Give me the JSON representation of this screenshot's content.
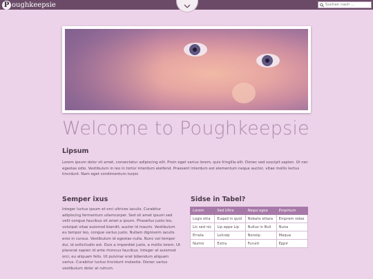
{
  "header": {
    "logo_letter": "P",
    "logo_text": "oughkeepsie",
    "menu_icon": "chevron-down-icon",
    "search_placeholder": "Suchen nach …"
  },
  "hero": {
    "image_alt": "baby face"
  },
  "page_title": "Welcome to Poughkeepsie",
  "section1": {
    "heading": "Lipsum",
    "text": "Lorem ipsum dolor sit amet, consectetur adipiscing elit. Proin eget varius lorem, quis fringilla elit. Donec sed suscipit sapien. Ut nec egestas odio. Vestibulum in leo in tortor interdum eleifend. Praesent interdum est elementum neque auctor, vitae mollis lectus tincidunt. Nam eget condimentum turpis"
  },
  "section2": {
    "heading": "Semper ixus",
    "text": "Integer luctus ipsum et orci ultrices iaculis. Curabitur adipiscing fermentum ullamcorper. Sed sit amet ipsum sed velit congue faucibus sit amet a ipsum. Phasellus justo leo, volutpat vitae euismod blandit, auctor id mauris. Vestibulum eu tempor leo, congue varius justo. Nullam dignissim iaculis eros in cursus. Vestibulum id egestas nulla. Nunc vel tempor dui, id sollicitudin est. Duis a imperdiet justo, a mollis lorem. Ut placerat sapien id ante rhoncus faucibus. Integer at euismod orci, eu aliquam felis. Ut pulvinar erat bibendum aliquam varius. Curabitur luctus tincidunt molestie. Donec varius vestibulum dolor at rutrum."
  },
  "section3": {
    "heading": "Sidse in Tabel?",
    "table": {
      "headers": [
        "Lorem",
        "Sed Ultra",
        "Nequi egsa",
        "Empirium"
      ],
      "rows": [
        [
          "Logis etta",
          "Euqad in quid",
          "Nobalis ettara",
          "Emprem sidse"
        ],
        [
          "Lic sed nic",
          "Lip eppe Lip",
          "Nullus in Bull",
          "Nuna"
        ],
        [
          "Errata",
          "Lolcoip",
          "Nonoip",
          "Maqua"
        ],
        [
          "Numis",
          "Extra",
          "Furunt",
          "Eppir"
        ]
      ]
    }
  },
  "colors": {
    "background": "#ecd3e9",
    "topbar": "#6a4a66",
    "title": "#b089ad",
    "table_header": "#a779a8"
  }
}
